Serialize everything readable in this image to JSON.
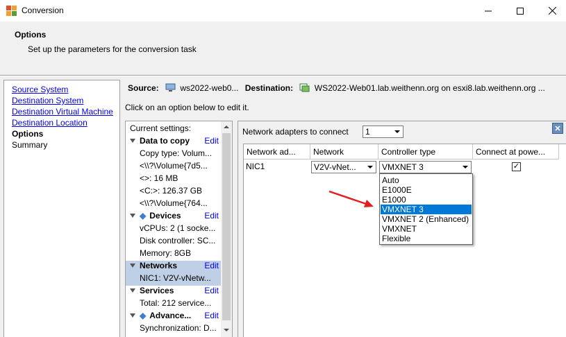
{
  "window": {
    "title": "Conversion",
    "controls": {
      "minimize": "minimize-icon",
      "maximize": "maximize-icon",
      "close": "close-icon"
    }
  },
  "header": {
    "title": "Options",
    "subtitle": "Set up the parameters for the conversion task"
  },
  "nav": {
    "items": [
      {
        "label": "Source System",
        "link": true
      },
      {
        "label": "Destination System",
        "link": true
      },
      {
        "label": "Destination Virtual Machine",
        "link": true
      },
      {
        "label": "Destination Location",
        "link": true
      },
      {
        "label": "Options",
        "link": false,
        "current": true
      },
      {
        "label": "Summary",
        "link": false
      }
    ]
  },
  "route": {
    "source_label": "Source:",
    "source_value": "ws2022-web0...",
    "destination_label": "Destination:",
    "destination_value": "WS2022-Web01.lab.weithenn.org on esxi8.lab.weithenn.org ..."
  },
  "hint": "Click on an option below to edit it.",
  "settings": {
    "heading": "Current settings:",
    "edit_label": "Edit",
    "rows": [
      {
        "kind": "section",
        "label": "Data to copy"
      },
      {
        "kind": "item",
        "label": "Copy type: Volum..."
      },
      {
        "kind": "item",
        "label": "<\\\\?\\Volume{7d5..."
      },
      {
        "kind": "item",
        "label": "<>: 16 MB"
      },
      {
        "kind": "item",
        "label": "<C:>: 126.37 GB"
      },
      {
        "kind": "item",
        "label": "<\\\\?\\Volume{764..."
      },
      {
        "kind": "section",
        "label": "Devices",
        "diamond": true
      },
      {
        "kind": "item",
        "label": "vCPUs: 2 (1 socke..."
      },
      {
        "kind": "item",
        "label": "Disk controller: SC..."
      },
      {
        "kind": "item",
        "label": "Memory: 8GB"
      },
      {
        "kind": "section",
        "label": "Networks",
        "highlight": true
      },
      {
        "kind": "item",
        "label": "NIC1: V2V-vNetw...",
        "highlight": true
      },
      {
        "kind": "section",
        "label": "Services"
      },
      {
        "kind": "item",
        "label": "Total: 212 service..."
      },
      {
        "kind": "section",
        "label": "Advance...",
        "diamond": true
      },
      {
        "kind": "item",
        "label": "Synchronization: D..."
      }
    ]
  },
  "network": {
    "adapters_label": "Network adapters to connect",
    "adapters_value": "1",
    "columns": [
      "Network ad...",
      "Network",
      "Controller type",
      "Connect at powe..."
    ],
    "rows": [
      {
        "adapter": "NIC1",
        "network": "V2V-vNet...",
        "controller": "VMXNET 3",
        "connect": true
      }
    ],
    "controller_options": [
      "Auto",
      "E1000E",
      "E1000",
      "VMXNET 3",
      "VMXNET 2 (Enhanced)",
      "VMXNET",
      "Flexible"
    ],
    "controller_selected": "VMXNET 3"
  },
  "colors": {
    "link": "#0000ee",
    "selection": "#0078d7",
    "highlight_row": "#bfcfe6",
    "annotation_arrow": "#e02020"
  }
}
